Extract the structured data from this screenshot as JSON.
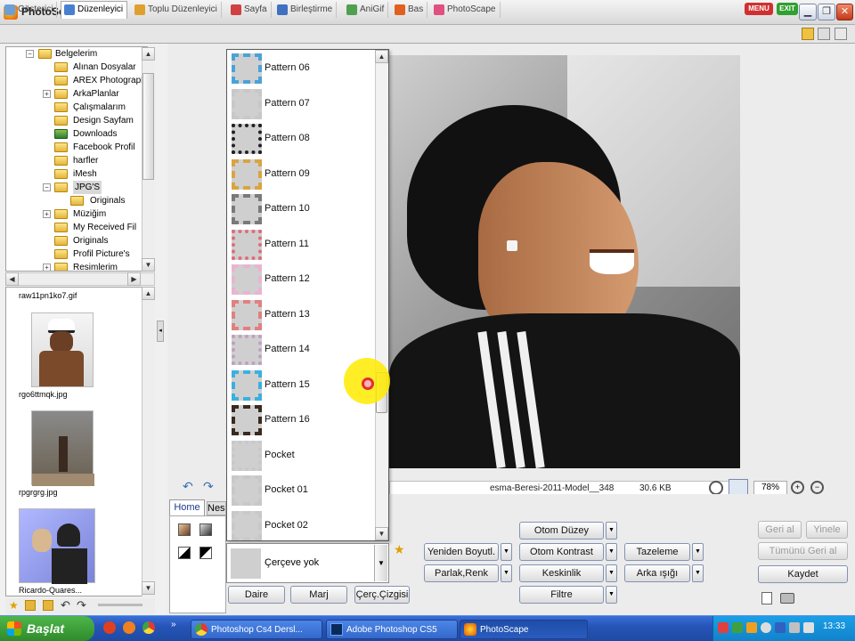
{
  "window": {
    "title": "PhotoScape"
  },
  "tabs": [
    {
      "label": "Gösterici"
    },
    {
      "label": "Düzenleyici"
    },
    {
      "label": "Toplu Düzenleyici"
    },
    {
      "label": "Sayfa"
    },
    {
      "label": "Birleştirme"
    },
    {
      "label": "AniGif"
    },
    {
      "label": "Bas"
    },
    {
      "label": "PhotoScape"
    }
  ],
  "top_right": {
    "menu": "MENU",
    "exit": "EXIT"
  },
  "tree": [
    {
      "label": "Belgelerim"
    },
    {
      "label": "Alınan Dosyalar"
    },
    {
      "label": "AREX Photograph"
    },
    {
      "label": "ArkaPlanlar"
    },
    {
      "label": "Çalışmalarım"
    },
    {
      "label": "Design Sayfam"
    },
    {
      "label": "Downloads"
    },
    {
      "label": "Facebook Profil"
    },
    {
      "label": "harfler"
    },
    {
      "label": "iMesh"
    },
    {
      "label": "JPG'S"
    },
    {
      "label": "Originals"
    },
    {
      "label": "Müziğim"
    },
    {
      "label": "My Received Fil"
    },
    {
      "label": "Originals"
    },
    {
      "label": "Profil Picture's"
    },
    {
      "label": "Resimlerim"
    }
  ],
  "thumbnails": [
    {
      "caption": "raw11pn1ko7.gif"
    },
    {
      "caption": "rgo6ttmqk.jpg"
    },
    {
      "caption": "rpgrgrg.jpg"
    },
    {
      "caption": "Ricardo-Quares..."
    }
  ],
  "frames": [
    {
      "label": "Pattern 06",
      "color": "#4aa3d8"
    },
    {
      "label": "Pattern 07",
      "color": "#c8c8c8"
    },
    {
      "label": "Pattern 08",
      "color": "#222222"
    },
    {
      "label": "Pattern 09",
      "color": "#d9a441"
    },
    {
      "label": "Pattern 10",
      "color": "#7a7a7a"
    },
    {
      "label": "Pattern 11",
      "color": "#e06c7a"
    },
    {
      "label": "Pattern 12",
      "color": "#e9b4d0"
    },
    {
      "label": "Pattern 13",
      "color": "#e08080"
    },
    {
      "label": "Pattern 14",
      "color": "#c0a0c0"
    },
    {
      "label": "Pattern 15",
      "color": "#3ab0e0"
    },
    {
      "label": "Pattern 16",
      "color": "#3a2a20"
    },
    {
      "label": "Pocket",
      "color": "#c8c8c8"
    },
    {
      "label": "Pocket 01",
      "color": "#c8c8c8"
    },
    {
      "label": "Pocket 02",
      "color": "#c8c8c8"
    }
  ],
  "frame_select": {
    "value": "Çerçeve yok"
  },
  "photo_info": {
    "filename": "esma-Beresi-2011-Model__348",
    "size": "30.6 KB",
    "zoom": "78%"
  },
  "home_tabs": {
    "home": "Home",
    "next": "Nes"
  },
  "frame_buttons": {
    "daire": "Daire",
    "marj": "Marj",
    "cerc": "Çerç.Çizgisi"
  },
  "tools": {
    "otom_duzey": "Otom Düzey",
    "yeniden": "Yeniden Boyutl.",
    "otom_kontrast": "Otom Kontrast",
    "tazeleme": "Tazeleme",
    "parlak": "Parlak,Renk",
    "keskinlik": "Keskinlik",
    "arka": "Arka ışığı",
    "filtre": "Filtre"
  },
  "actions": {
    "geri": "Geri al",
    "yinele": "Yinele",
    "tumunu": "Tümünü Geri al",
    "kaydet": "Kaydet"
  },
  "taskbar": {
    "start": "Başlat",
    "items": [
      {
        "label": "Photoshop Cs4 Dersl..."
      },
      {
        "label": "Adobe Photoshop CS5"
      },
      {
        "label": "PhotoScape"
      }
    ],
    "clock": "13:33"
  }
}
